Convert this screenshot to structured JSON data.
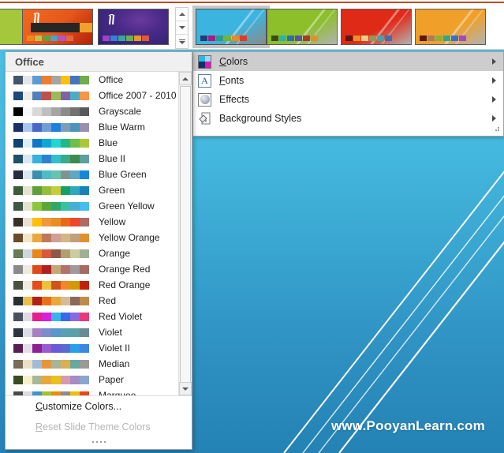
{
  "window": {
    "watermark": "www.PooyanLearn.com",
    "accent_color": "#c0481b",
    "slide_bg_top": "#4cc3e4",
    "slide_bg_bottom": "#2482b4"
  },
  "ribbon_gallery": {
    "scroll_up_label": "scroll-up",
    "scroll_down_label": "scroll-down",
    "more_label": "more-themes",
    "thumbnails": [
      {
        "name": "theme-green-partial",
        "bg": "#a5c73c",
        "selected": false,
        "partial": true,
        "swatches": []
      },
      {
        "name": "theme-orange-berlin",
        "bg": "#e8571a",
        "selected": false,
        "partial": false,
        "swatches": [
          "#e8891e",
          "#b6c64a",
          "#4ea846",
          "#3fa9c9",
          "#b255c9",
          "#e4654a"
        ]
      },
      {
        "name": "theme-purple-savon",
        "bg": "#3a2e7e",
        "selected": false,
        "partial": false,
        "swatches": [
          "#a23fc4",
          "#3a7fd5",
          "#35a7a0",
          "#6cb04a",
          "#e59a2a",
          "#e0573d"
        ]
      },
      {
        "name": "variant-blue",
        "bg": "#3cb4e0",
        "selected": true,
        "partial": false,
        "swatches": [
          "#1f3f74",
          "#a81a84",
          "#2e9a8e",
          "#6db63c",
          "#e8892a",
          "#e03a2a"
        ]
      },
      {
        "name": "variant-green",
        "bg": "#8cbf2a",
        "selected": false,
        "partial": false,
        "swatches": [
          "#3a4a22",
          "#2fb0b0",
          "#2e6fa8",
          "#5a52a8",
          "#a83a2a",
          "#e0912a"
        ]
      },
      {
        "name": "variant-red",
        "bg": "#e02a18",
        "selected": false,
        "partial": false,
        "swatches": [
          "#5a1a10",
          "#e8912a",
          "#e8d080",
          "#8a9a5a",
          "#3aa8b0",
          "#3a6fb0"
        ]
      },
      {
        "name": "variant-orange",
        "bg": "#f0a028",
        "selected": false,
        "partial": false,
        "swatches": [
          "#5a1a10",
          "#b07a5a",
          "#8cb03a",
          "#2fa888",
          "#3a6fd0",
          "#a04ac0"
        ]
      }
    ]
  },
  "variants_menu": {
    "items": [
      {
        "name": "colors",
        "label": "Colors",
        "accel": "C",
        "icon": "colors-icon",
        "highlighted": true,
        "has_submenu": true
      },
      {
        "name": "fonts",
        "label": "Fonts",
        "accel": "F",
        "icon": "fonts-icon",
        "highlighted": false,
        "has_submenu": true
      },
      {
        "name": "effects",
        "label": "Effects",
        "accel": "",
        "icon": "effects-icon",
        "highlighted": false,
        "has_submenu": true
      },
      {
        "name": "background-styles",
        "label": "Background Styles",
        "accel": "",
        "icon": "background-styles-icon",
        "highlighted": false,
        "has_submenu": true
      }
    ]
  },
  "colors_dropdown": {
    "header": "Office",
    "scroll_up_label": "scroll-up",
    "scroll_down_label": "scroll-down",
    "footer": [
      {
        "name": "customize-colors",
        "label": "Customize Colors...",
        "accel": "C",
        "disabled": false
      },
      {
        "name": "reset-slide-theme-colors",
        "label": "Reset Slide Theme Colors",
        "accel": "R",
        "disabled": true
      }
    ],
    "themes": [
      {
        "name": "Office",
        "colors": [
          "#44546a",
          "#e7e6e6",
          "#5b9bd5",
          "#ed7d31",
          "#a5a5a5",
          "#ffc000",
          "#4472c4",
          "#70ad47"
        ]
      },
      {
        "name": "Office 2007 - 2010",
        "colors": [
          "#1f497d",
          "#eeece1",
          "#4f81bd",
          "#c0504d",
          "#9bbb59",
          "#8064a2",
          "#4bacc6",
          "#f79646"
        ]
      },
      {
        "name": "Grayscale",
        "colors": [
          "#000000",
          "#f8f8f8",
          "#d8d8d8",
          "#bfbfbf",
          "#a5a5a5",
          "#8c8c8c",
          "#727272",
          "#595959"
        ]
      },
      {
        "name": "Blue Warm",
        "colors": [
          "#1a2f63",
          "#a8c6f0",
          "#4a66c8",
          "#6e9ed6",
          "#1f7fe0",
          "#7e9cb8",
          "#4a96b8",
          "#9a8fb0"
        ]
      },
      {
        "name": "Blue",
        "colors": [
          "#0f4270",
          "#dfeef5",
          "#0f76c8",
          "#0ea5d8",
          "#1fd6d0",
          "#20b884",
          "#6cbf4a",
          "#aac73a"
        ]
      },
      {
        "name": "Blue II",
        "colors": [
          "#1c5269",
          "#dfe6ec",
          "#34b3e0",
          "#2a83cc",
          "#32c0c8",
          "#3aab8a",
          "#3c8c52",
          "#5f9e9e"
        ]
      },
      {
        "name": "Blue Green",
        "colors": [
          "#262b40",
          "#dce6ee",
          "#3b90ad",
          "#4ebcc4",
          "#64c4b0",
          "#7f9393",
          "#62a6c4",
          "#1787d8"
        ]
      },
      {
        "name": "Green",
        "colors": [
          "#3d5c3a",
          "#e6e2d2",
          "#5ea03a",
          "#96bd3a",
          "#c8cc3a",
          "#15a06a",
          "#2fa8c0",
          "#1782b8"
        ]
      },
      {
        "name": "Green Yellow",
        "colors": [
          "#3d5946",
          "#e4e2d0",
          "#8cc63a",
          "#5aa83a",
          "#2fa86a",
          "#34c2a0",
          "#4aadd6",
          "#46bdf0"
        ]
      },
      {
        "name": "Yellow",
        "colors": [
          "#3a2f26",
          "#e6e0da",
          "#ffc000",
          "#f0973a",
          "#e88c26",
          "#e8671a",
          "#f0452a",
          "#ad6a62"
        ]
      },
      {
        "name": "Yellow Orange",
        "colors": [
          "#6a4a2a",
          "#f2e6c8",
          "#e8a83a",
          "#bd7a5a",
          "#d0a096",
          "#d6b486",
          "#bfa27a",
          "#e09030"
        ]
      },
      {
        "name": "Orange",
        "colors": [
          "#6a7a52",
          "#cbd7e2",
          "#e8861a",
          "#d6593a",
          "#8c5a46",
          "#b0a070",
          "#cfcba0",
          "#9eb096"
        ]
      },
      {
        "name": "Orange Red",
        "colors": [
          "#8a8a8a",
          "#ecebe0",
          "#e04a1a",
          "#b02020",
          "#c4a878",
          "#b4726a",
          "#a09a9a",
          "#a56a62"
        ]
      },
      {
        "name": "Red Orange",
        "colors": [
          "#4a4f42",
          "#eeece0",
          "#e84a1a",
          "#f0c03a",
          "#d0541a",
          "#f0882a",
          "#d09a00",
          "#c42008"
        ]
      },
      {
        "name": "Red",
        "colors": [
          "#2a2d32",
          "#e8c04a",
          "#b42018",
          "#e8701a",
          "#e8a83a",
          "#d4bc96",
          "#8a6a5a",
          "#c08a4a"
        ]
      },
      {
        "name": "Red Violet",
        "colors": [
          "#4a4f5e",
          "#d9dde2",
          "#e81e8c",
          "#d820d8",
          "#3ab4e8",
          "#3a6ae8",
          "#8a6ae0",
          "#e83a7a"
        ]
      },
      {
        "name": "Violet",
        "colors": [
          "#2e3342",
          "#dcdee4",
          "#a87ec4",
          "#7e8ccc",
          "#5a96c8",
          "#5aa0b4",
          "#5aa0a8",
          "#6a8a96"
        ]
      },
      {
        "name": "Violet II",
        "colors": [
          "#5a1e56",
          "#e2e0e6",
          "#8c1e96",
          "#9a5ad0",
          "#6a5ad8",
          "#5a6ad0",
          "#2aa0e8",
          "#3a86e0"
        ]
      },
      {
        "name": "Median",
        "colors": [
          "#7a6a5a",
          "#ece0c4",
          "#9ebcd8",
          "#e8953a",
          "#aab496",
          "#dcb050",
          "#6aa89e",
          "#9a9a96"
        ]
      },
      {
        "name": "Paper",
        "colors": [
          "#3a4a22",
          "#f7f0c8",
          "#a8b896",
          "#e8a83a",
          "#e8c020",
          "#d69ab0",
          "#a88ac4",
          "#8aa6cc"
        ]
      },
      {
        "name": "Marquee",
        "colors": [
          "#4a4a4a",
          "#dcdcdc",
          "#3a96d0",
          "#a0c42a",
          "#f08c00",
          "#8c8c8c",
          "#f0c000",
          "#e8461a"
        ]
      }
    ]
  }
}
